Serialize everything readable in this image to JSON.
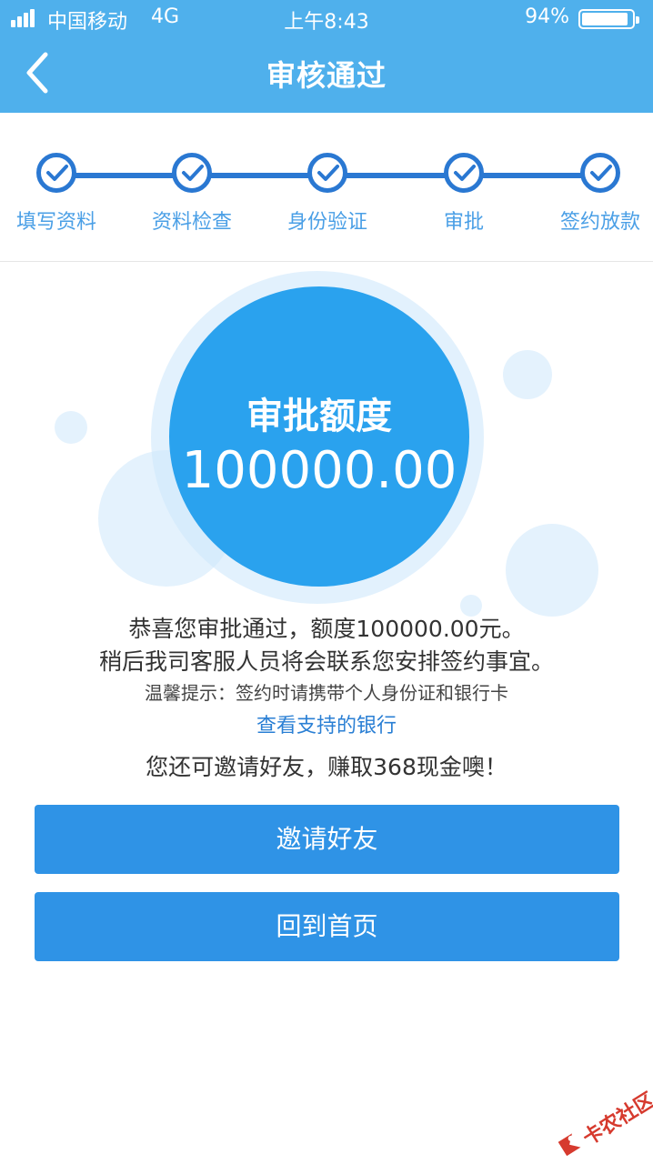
{
  "status_bar": {
    "carrier": "中国移动",
    "network": "4G",
    "time": "上午8:43",
    "battery": "94%",
    "battery_level": 0.94
  },
  "nav": {
    "title": "审核通过",
    "back_icon": "chevron-left-icon"
  },
  "steps": [
    {
      "label": "填写资料",
      "done": true
    },
    {
      "label": "资料检查",
      "done": true
    },
    {
      "label": "身份验证",
      "done": true
    },
    {
      "label": "审批",
      "done": true
    },
    {
      "label": "签约放款",
      "done": true
    }
  ],
  "approval": {
    "title": "审批额度",
    "amount": "100000.00"
  },
  "messages": {
    "congrats": "恭喜您审批通过，额度100000.00元。",
    "contact": "稍后我司客服人员将会联系您安排签约事宜。",
    "tip": "温馨提示：签约时请携带个人身份证和银行卡",
    "banks_link": "查看支持的银行",
    "invite_text": "您还可邀请好友，赚取368现金噢！"
  },
  "buttons": {
    "invite": "邀请好友",
    "home": "回到首页"
  },
  "watermark": {
    "text": "卡农社区"
  },
  "colors": {
    "header": "#4fb0ec",
    "accent": "#2a78d2",
    "circle": "#2aa2ee",
    "button": "#2f93e6",
    "link": "#2a7fd4"
  }
}
